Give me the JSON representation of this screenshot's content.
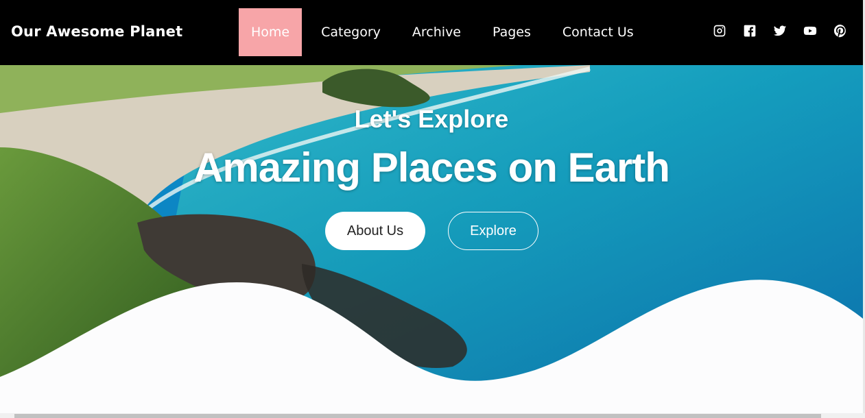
{
  "brand": "Our Awesome Planet",
  "nav": {
    "items": [
      {
        "label": "Home",
        "active": true
      },
      {
        "label": "Category",
        "active": false
      },
      {
        "label": "Archive",
        "active": false
      },
      {
        "label": "Pages",
        "active": false
      },
      {
        "label": "Contact Us",
        "active": false
      }
    ],
    "active_color": "#f7a5a8"
  },
  "social": [
    "instagram-icon",
    "facebook-icon",
    "twitter-icon",
    "youtube-icon",
    "pinterest-icon"
  ],
  "hero": {
    "subtitle": "Let's Explore",
    "title": "Amazing Places on Earth",
    "buttons": {
      "about": "About Us",
      "explore": "Explore"
    }
  },
  "colors": {
    "navbar": "#000000",
    "ocean": "#1fa3c4",
    "wave": "#ffffff"
  }
}
